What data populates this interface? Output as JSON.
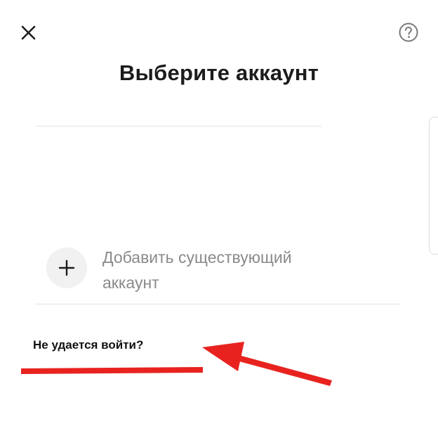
{
  "header": {
    "close_icon": "close-icon",
    "help_icon": "help-icon",
    "title": "Выберите аккаунт"
  },
  "accounts": {
    "add_existing_label": "Добавить существующий аккаунт",
    "add_icon": "plus-icon"
  },
  "footer": {
    "cant_login_link": "Не удается войти?"
  },
  "colors": {
    "annotation": "#e8231f",
    "title_text": "#1c1c1c",
    "secondary_text": "#8a8a8a",
    "divider": "#e3e3e3"
  }
}
